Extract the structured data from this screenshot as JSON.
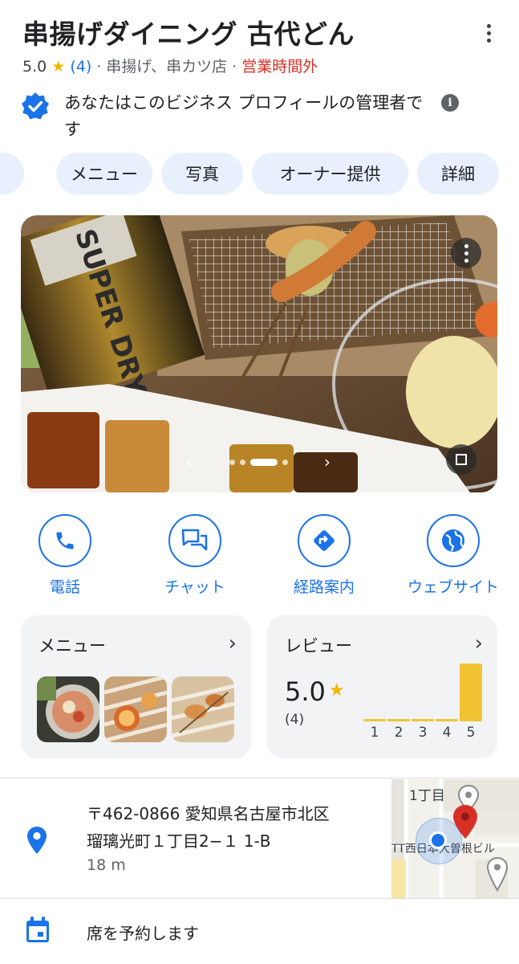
{
  "header": {
    "title": "串揚げダイニング 古代どん",
    "rating": "5.0",
    "star": "★",
    "review_count": "(4)",
    "category": "· 串揚げ、串カツ店 ·",
    "status": "営業時間外",
    "status_color": "#d93025"
  },
  "owner_notice": {
    "text": "あなたはこのビジネス プロフィールの管理者です",
    "info_glyph": "i"
  },
  "chips": [
    "メニュー",
    "写真",
    "オーナー提供",
    "詳細"
  ],
  "photo": {
    "label": "SUPER DRY",
    "prev": "‹",
    "next": "›"
  },
  "actions": [
    {
      "label": "電話",
      "icon": "phone-icon"
    },
    {
      "label": "チャット",
      "icon": "chat-icon"
    },
    {
      "label": "経路案内",
      "icon": "directions-icon"
    },
    {
      "label": "ウェブサイト",
      "icon": "globe-icon"
    }
  ],
  "menu_card": {
    "title": "メニュー",
    "chevron": "›"
  },
  "review_card": {
    "title": "レビュー",
    "chevron": "›",
    "rating": "5.0",
    "star": "★",
    "count": "(4)",
    "distribution": [
      {
        "stars": "1",
        "count": 0
      },
      {
        "stars": "2",
        "count": 0
      },
      {
        "stars": "3",
        "count": 0
      },
      {
        "stars": "4",
        "count": 0
      },
      {
        "stars": "5",
        "count": 4
      }
    ]
  },
  "address": {
    "line1": "〒462-0866 愛知県名古屋市北区",
    "line2": "瑠璃光町１丁目2−１ 1-B",
    "distance": "18 m"
  },
  "map": {
    "label_top": "1丁目",
    "label_street": "TT西日本大曽根ビル"
  },
  "reserve": {
    "label": "席を予約します"
  },
  "colors": {
    "accent": "#1a73e8",
    "chip_bg": "#e8f0fe",
    "star": "#f4b400",
    "bar": "#f1c232",
    "card_bg": "#f1f3f4"
  }
}
